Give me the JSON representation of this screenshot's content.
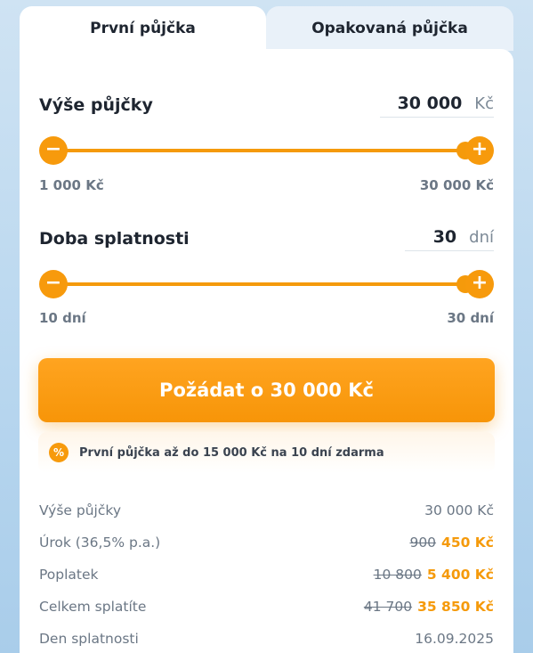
{
  "tabs": [
    {
      "label": "První půjčka",
      "active": true
    },
    {
      "label": "Opakovaná půjčka",
      "active": false
    }
  ],
  "amount": {
    "label": "Výše půjčky",
    "value": "30 000",
    "unit": "Kč",
    "min_label": "1 000 Kč",
    "max_label": "30 000 Kč",
    "slider_fraction": 1.0
  },
  "term": {
    "label": "Doba splatnosti",
    "value": "30",
    "unit": "dní",
    "min_label": "10 dní",
    "max_label": "30 dní",
    "slider_fraction": 1.0
  },
  "cta": {
    "label": "Požádat o 30 000 Kč"
  },
  "promo": {
    "icon": "percent-icon",
    "text": "První půjčka až do 15 000 Kč na 10 dní zdarma"
  },
  "summary": [
    {
      "label": "Výše půjčky",
      "value": "30 000 Kč"
    },
    {
      "label": "Úrok (36,5% p.a.)",
      "old": "900",
      "new": "450 Kč"
    },
    {
      "label": "Poplatek",
      "old": "10 800",
      "new": "5 400 Kč"
    },
    {
      "label": "Celkem splatíte",
      "old": "41 700",
      "new": "35 850 Kč"
    },
    {
      "label": "Den splatnosti",
      "value": "16.09.2025"
    }
  ],
  "colors": {
    "accent": "#f79a0c",
    "text": "#1e2530",
    "muted": "#6b7785"
  }
}
